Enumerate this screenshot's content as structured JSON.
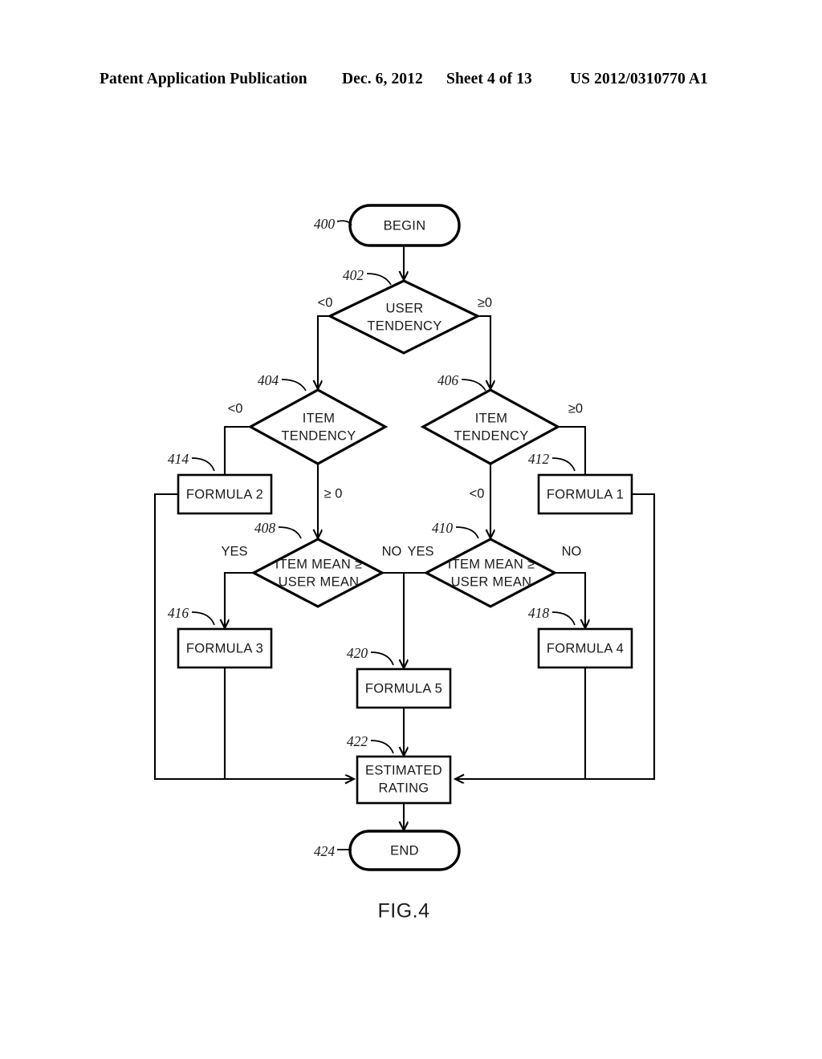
{
  "header": {
    "publication": "Patent Application Publication",
    "date": "Dec. 6, 2012",
    "sheet": "Sheet 4 of 13",
    "patent_number": "US 2012/0310770 A1"
  },
  "figure": {
    "caption": "FIG.4"
  },
  "nodes": {
    "begin": {
      "label": "BEGIN",
      "ref": "400"
    },
    "user_tendency": {
      "line1": "USER",
      "line2": "TENDENCY",
      "ref": "402"
    },
    "item_tendency_left": {
      "line1": "ITEM",
      "line2": "TENDENCY",
      "ref": "404"
    },
    "item_tendency_right": {
      "line1": "ITEM",
      "line2": "TENDENCY",
      "ref": "406"
    },
    "item_mean_left": {
      "line1": "ITEM MEAN ≥",
      "line2": "USER MEAN",
      "ref": "408"
    },
    "item_mean_right": {
      "line1": "ITEM MEAN ≥",
      "line2": "USER MEAN",
      "ref": "410"
    },
    "formula1": {
      "label": "FORMULA 1",
      "ref": "412"
    },
    "formula2": {
      "label": "FORMULA 2",
      "ref": "414"
    },
    "formula3": {
      "label": "FORMULA 3",
      "ref": "416"
    },
    "formula4": {
      "label": "FORMULA 4",
      "ref": "418"
    },
    "formula5": {
      "label": "FORMULA 5",
      "ref": "420"
    },
    "estimated_rating": {
      "line1": "ESTIMATED",
      "line2": "RATING",
      "ref": "422"
    },
    "end": {
      "label": "END",
      "ref": "424"
    }
  },
  "edge_labels": {
    "user_tendency_left": "<0",
    "user_tendency_right": "≥0",
    "item_tendency_left_neg": "<0",
    "item_tendency_left_pos": "≥ 0",
    "item_tendency_right_pos": "≥0",
    "item_tendency_right_neg": "<0",
    "item_mean_left_yes": "YES",
    "item_mean_left_no": "NO",
    "item_mean_right_yes": "YES",
    "item_mean_right_no": "NO"
  },
  "colors": {
    "stroke": "#000000",
    "background": "#ffffff",
    "text": "#1a1a1a"
  }
}
